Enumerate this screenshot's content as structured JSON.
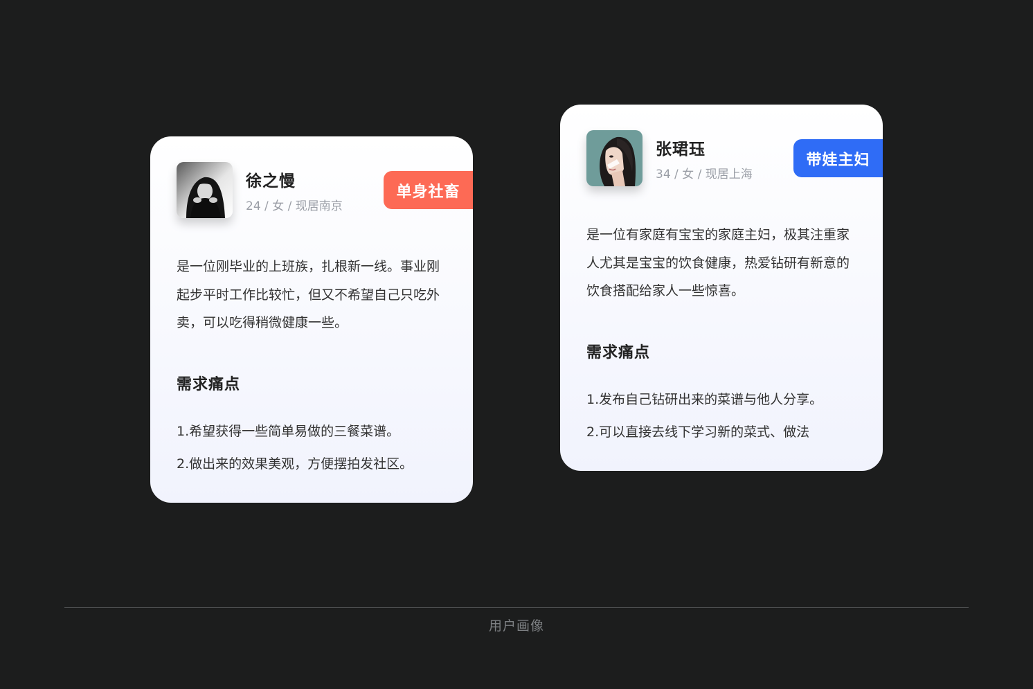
{
  "personas": [
    {
      "name": "徐之慢",
      "meta": "24 / 女 / 现居南京",
      "tag": "单身社畜",
      "tag_color": "#fd6a55",
      "avatar_icon": "woman-covering-face-bw-photo-icon",
      "description": "是一位刚毕业的上班族，扎根新一线。事业刚起步平时工作比较忙，但又不希望自己只吃外卖，可以吃得稍微健康一些。",
      "needs_title": "需求痛点",
      "needs": [
        "1.希望获得一些简单易做的三餐菜谱。",
        "2.做出来的效果美观，方便摆拍发社区。"
      ]
    },
    {
      "name": "张珺珏",
      "meta": "34 / 女 / 现居上海",
      "tag": "带娃主妇",
      "tag_color": "#2f6cf6",
      "avatar_icon": "woman-profile-illustration-icon",
      "description": "是一位有家庭有宝宝的家庭主妇，极其注重家人尤其是宝宝的饮食健康，热爱钻研有新意的饮食搭配给家人一些惊喜。",
      "needs_title": "需求痛点",
      "needs": [
        "1.发布自己钻研出来的菜谱与他人分享。",
        "2.可以直接去线下学习新的菜式、做法"
      ]
    }
  ],
  "footer": {
    "caption": "用户画像"
  }
}
